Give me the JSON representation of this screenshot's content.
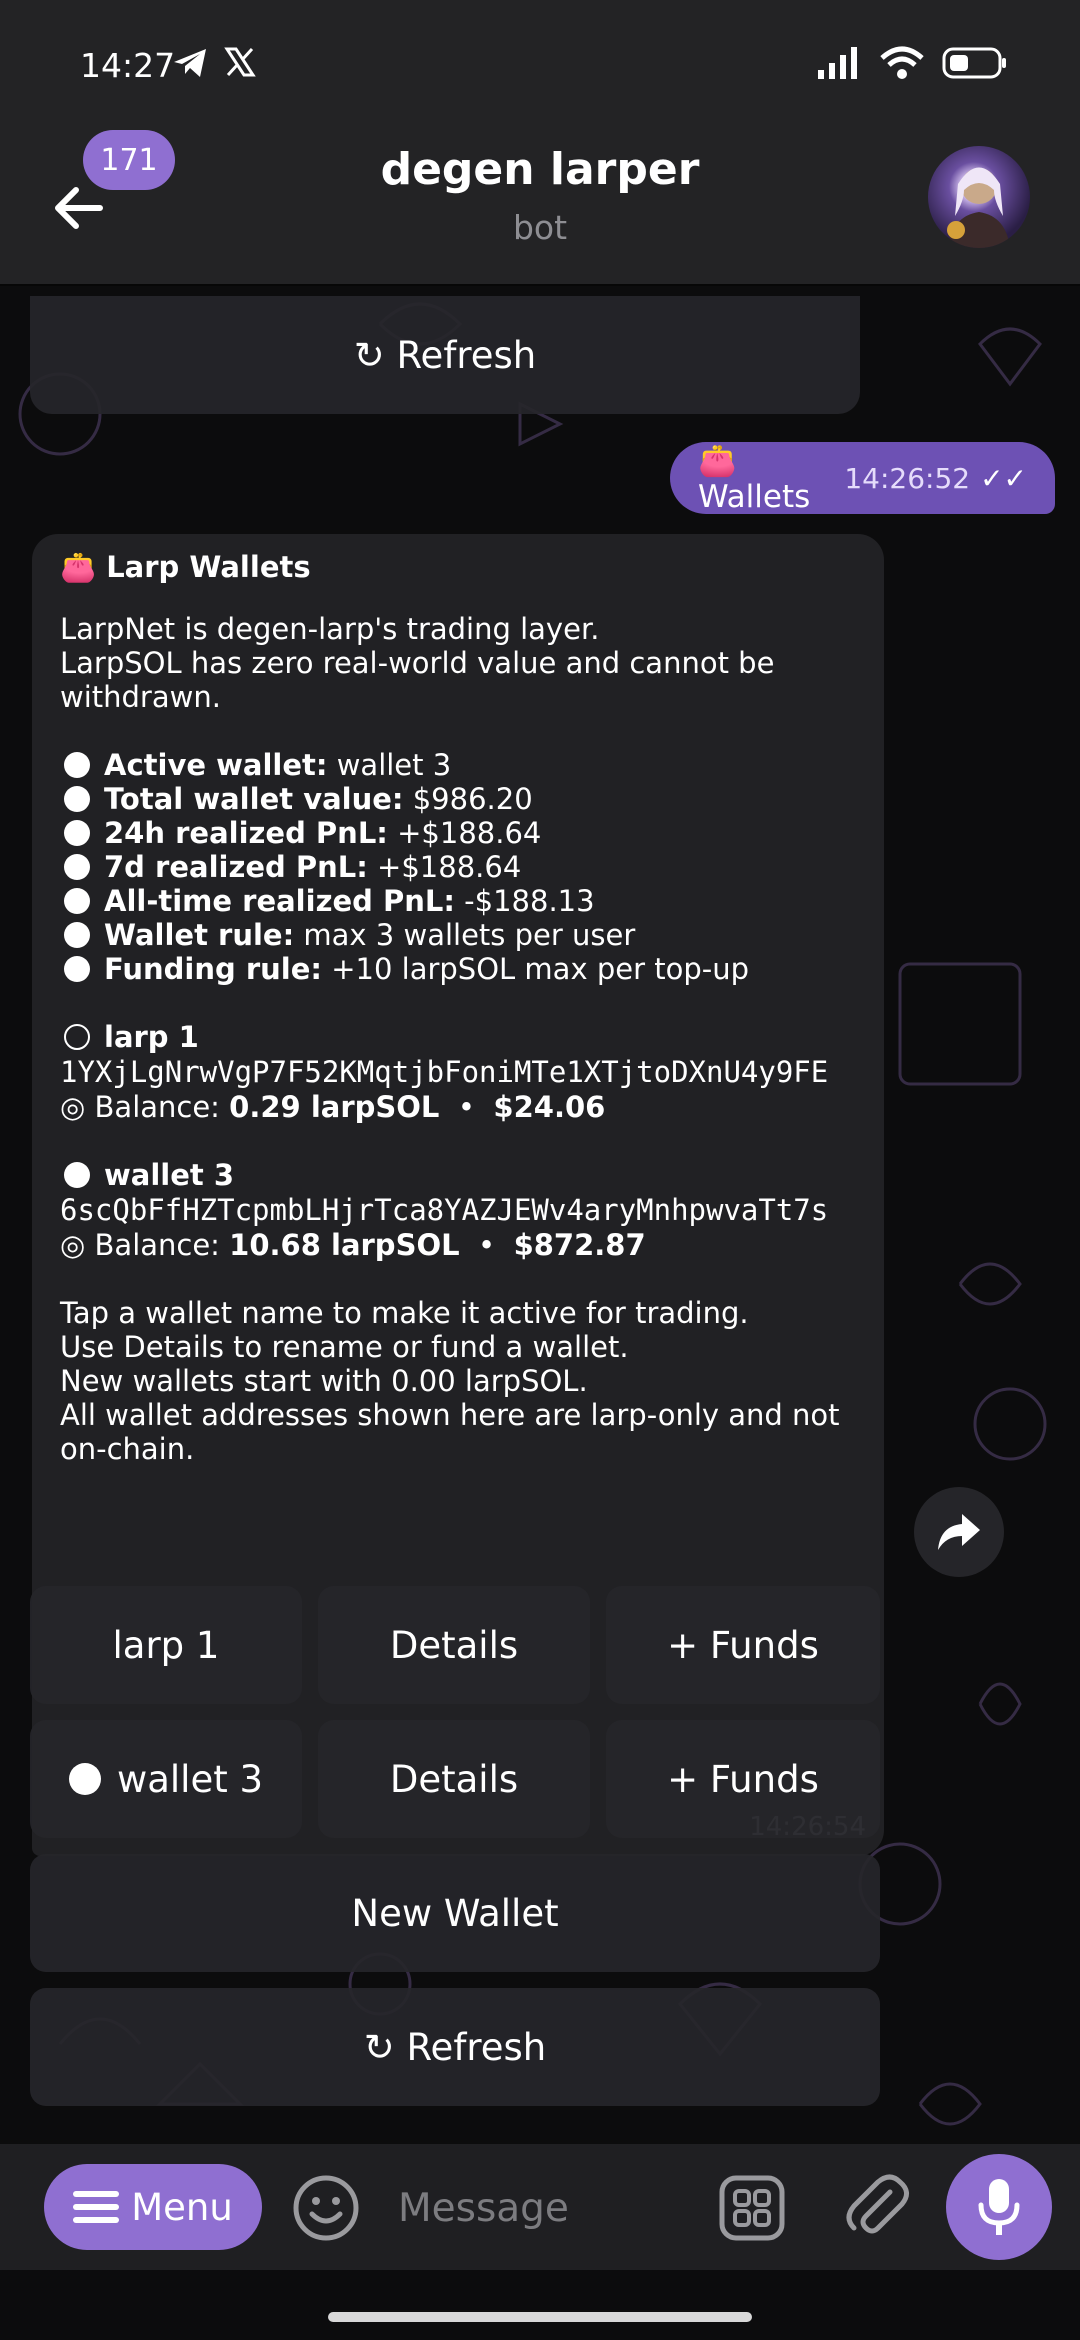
{
  "status": {
    "time": "14:27"
  },
  "header": {
    "badge": "171",
    "title": "degen larper",
    "subtitle": "bot"
  },
  "keyboard_top": {
    "refresh": "↻ Refresh"
  },
  "outgoing": {
    "text": "👛 Wallets",
    "time": "14:26:52",
    "checks": "✓✓"
  },
  "message": {
    "title": "👛 Larp Wallets",
    "intro_1": "LarpNet is degen-larp's trading layer.",
    "intro_2": "LarpSOL has zero real-world value and cannot be withdrawn.",
    "stats": [
      {
        "label": "Active wallet:",
        "value": " wallet 3"
      },
      {
        "label": "Total wallet value:",
        "value": " $986.20"
      },
      {
        "label": "24h realized PnL:",
        "value": " +$188.64"
      },
      {
        "label": "7d realized PnL:",
        "value": " +$188.64"
      },
      {
        "label": "All-time realized PnL:",
        "value": " -$188.13"
      },
      {
        "label": "Wallet rule:",
        "value": " max 3 wallets per user"
      },
      {
        "label": "Funding rule:",
        "value": " +10 larpSOL max per top-up"
      }
    ],
    "wallets": [
      {
        "name": "larp 1",
        "address": "1YXjLgNrwVgP7F52KMqtjbFoniMTe1XTjtoDXnU4y9FE",
        "balance_label": "◎ Balance:",
        "balance": "0.29 larpSOL",
        "sep": "•",
        "usd": "$24.06"
      },
      {
        "name": "wallet 3",
        "address": "6scQbFfHZTcpmbLHjrTca8YAZJEWv4aryMnhpwvaTt7s",
        "balance_label": "◎ Balance:",
        "balance": "10.68 larpSOL",
        "sep": "•",
        "usd": "$872.87"
      }
    ],
    "footer_1": "Tap a wallet name to make it active for trading.",
    "footer_2": "Use Details to rename or fund a wallet.",
    "footer_3": "New wallets start with 0.00 larpSOL.",
    "footer_4": "All wallet addresses shown here are larp-only and not on-chain.",
    "time": "14:26:54"
  },
  "keyboard": {
    "row1": [
      "larp 1",
      "Details",
      "+ Funds"
    ],
    "row2": [
      "wallet 3",
      "Details",
      "+ Funds"
    ],
    "new_wallet": "New Wallet",
    "refresh": "↻ Refresh"
  },
  "input": {
    "menu": "Menu",
    "placeholder": "Message"
  },
  "colors": {
    "accent": "#8f6fd1",
    "outgoing_bubble": "#6d51b4",
    "bubble": "#212124",
    "bar": "#232325"
  }
}
